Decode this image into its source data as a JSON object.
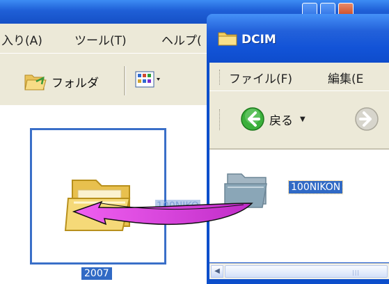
{
  "back_window": {
    "menu": [
      {
        "label": "入り(A)"
      },
      {
        "label": "ツール(T)"
      },
      {
        "label": "ヘルプ("
      }
    ],
    "toolbar": {
      "folders_label": "フォルダ",
      "views_icon": "views-icon"
    },
    "folder_item": {
      "name": "2007"
    },
    "drag_ghost_label": "100NIKO"
  },
  "front_window": {
    "title": "DCIM",
    "menu": [
      {
        "label": "ファイル(F)"
      },
      {
        "label": "編集(E"
      }
    ],
    "toolbar": {
      "back_label": "戻る"
    },
    "item": {
      "name": "100NIKON"
    }
  },
  "colors": {
    "titlebar": "#0c4ecb",
    "selection": "#316ac5",
    "arrow": "#e040e0"
  }
}
